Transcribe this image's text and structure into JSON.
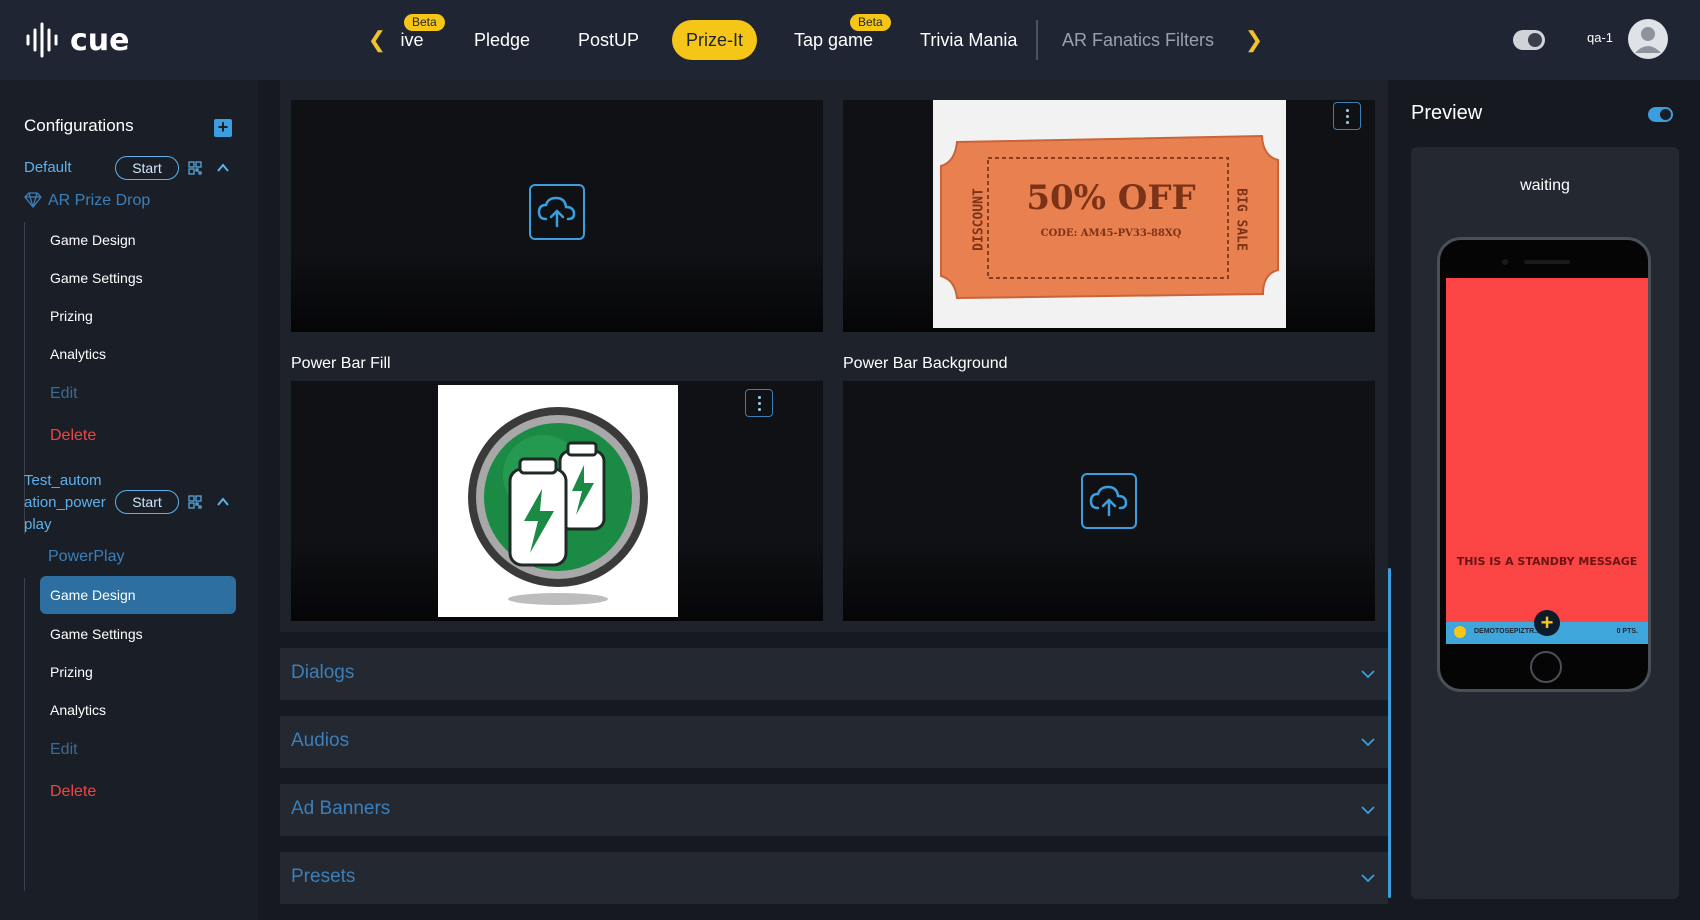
{
  "app": {
    "logo_text": "cue"
  },
  "nav": {
    "tabs": [
      {
        "label": "ive",
        "beta": "Beta"
      },
      {
        "label": "Pledge"
      },
      {
        "label": "PostUP"
      },
      {
        "label": "Prize-It",
        "active": true
      },
      {
        "label": "Tap game",
        "beta": "Beta"
      },
      {
        "label": "Trivia Mania"
      },
      {
        "label": "AR Fanatics Filters"
      }
    ],
    "user": "qa-1"
  },
  "sidebar": {
    "title": "Configurations",
    "configs": [
      {
        "name": "Default",
        "start_label": "Start",
        "game_type": "AR Prize Drop",
        "items": [
          "Game Design",
          "Game Settings",
          "Prizing",
          "Analytics",
          "Edit",
          "Delete"
        ]
      },
      {
        "name_lines": [
          "Test_autom",
          "ation_power",
          "play"
        ],
        "start_label": "Start",
        "game_type": "PowerPlay",
        "items": [
          "Game Design",
          "Game Settings",
          "Prizing",
          "Analytics",
          "Edit",
          "Delete"
        ],
        "selected": "Game Design"
      }
    ]
  },
  "main": {
    "fields": [
      {
        "label": "Power Bar Fill"
      },
      {
        "label": "Power Bar Background"
      }
    ],
    "coupon": {
      "headline": "50% OFF",
      "code": "CODE: AM45-PV33-88XQ",
      "left": "DISCOUNT",
      "right": "BIG SALE"
    },
    "accordions": [
      "Dialogs",
      "Audios",
      "Ad Banners",
      "Presets"
    ]
  },
  "preview": {
    "title": "Preview",
    "status": "waiting",
    "standby_message": "THIS IS A STANDBY MESSAGE",
    "user_label": "DEMOTOSEPIZTR...",
    "points": "0 PTS."
  },
  "colors": {
    "accent": "#3c9ede",
    "brand_yellow": "#f5c518",
    "danger": "#f04444",
    "standby_bg": "#fb4545"
  }
}
